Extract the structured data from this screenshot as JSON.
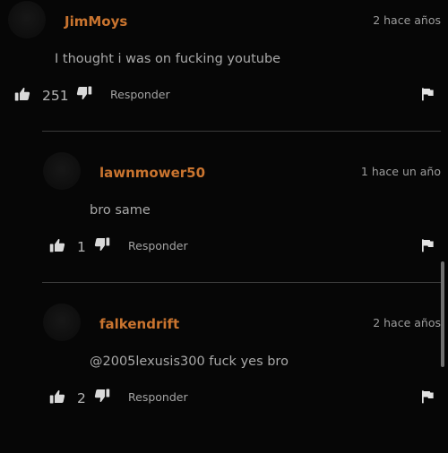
{
  "comments": [
    {
      "username": "JimMoys",
      "time": "2 hace años",
      "text": "I thought i was on fucking youtube",
      "likes": "251",
      "reply_label": "Responder"
    },
    {
      "username": "lawnmower50",
      "time": "1 hace un año",
      "text": "bro same",
      "likes": "1",
      "reply_label": "Responder"
    },
    {
      "username": "falkendrift",
      "time": "2 hace años",
      "text": "@2005lexusis300 fuck yes bro",
      "likes": "2",
      "reply_label": "Responder"
    }
  ],
  "icons": {
    "like": "thumbs-up-icon",
    "dislike": "thumbs-down-icon",
    "report": "flag-icon"
  },
  "colors": {
    "background": "#060606",
    "username": "#c9742f",
    "divider": "#3c3c3c"
  }
}
